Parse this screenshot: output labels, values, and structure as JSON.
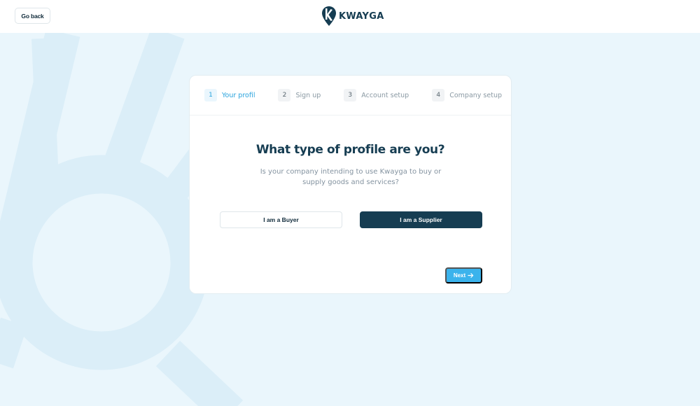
{
  "header": {
    "go_back_label": "Go back",
    "logo_text": "KWAYGA"
  },
  "steps": [
    {
      "number": "1",
      "label": "Your profil",
      "active": true
    },
    {
      "number": "2",
      "label": "Sign up",
      "active": false
    },
    {
      "number": "3",
      "label": "Account setup",
      "active": false
    },
    {
      "number": "4",
      "label": "Company setup",
      "active": false
    }
  ],
  "main": {
    "title": "What type of profile are you?",
    "subtitle": "Is your company intending to use Kwayga to buy or supply goods and services?",
    "buyer_label": "I am a Buyer",
    "supplier_label": "I am a Supplier",
    "next_label": "Next",
    "selected": "supplier"
  },
  "icons": {
    "logo": "map-pin-k-logo-icon",
    "next_arrow": "arrow-right-icon"
  },
  "colors": {
    "brand_dark": "#163d52",
    "accent": "#3bb3ec",
    "step_active": "#27a2dd",
    "background": "#eaf6fc"
  }
}
